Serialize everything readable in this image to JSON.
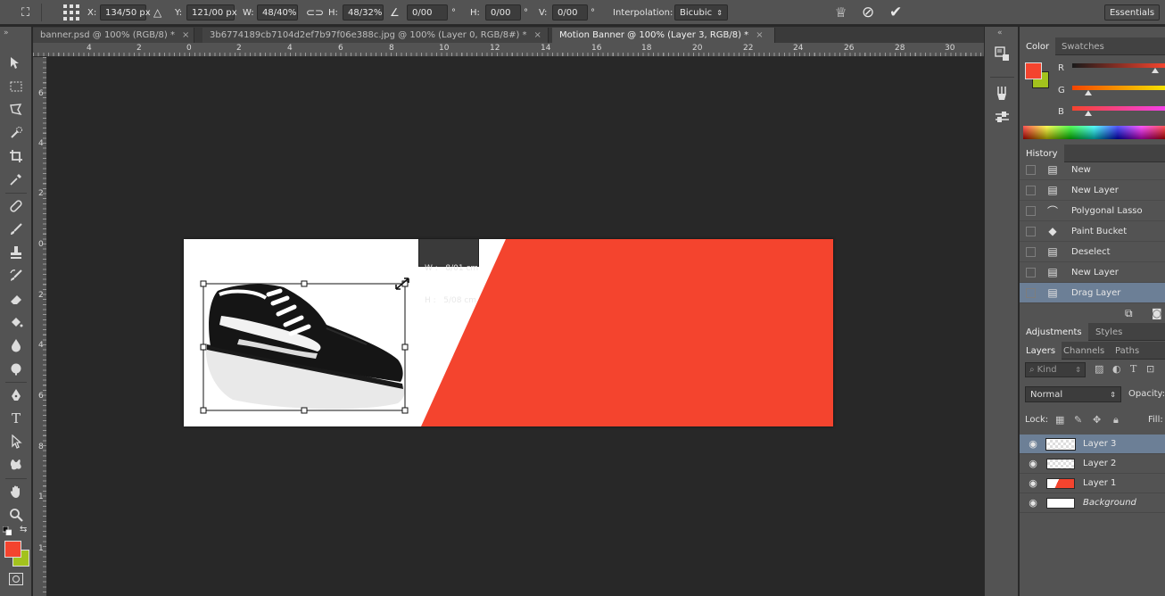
{
  "options": {
    "x_label": "X:",
    "x_value": "134/50 px",
    "delta_icon": "triangle-icon",
    "y_label": "Y:",
    "y_value": "121/00 px",
    "w_label": "W:",
    "w_value": "48/40%",
    "h_label": "H:",
    "h_value": "48/32%",
    "angle_value": "0/00",
    "degree_symbol": "°",
    "hskew_label": "H:",
    "hskew_value": "0/00",
    "vskew_label": "V:",
    "vskew_value": "0/00",
    "interp_label": "Interpolation:",
    "interp_value": "Bicubic",
    "workspace": "Essentials"
  },
  "tabs": [
    {
      "label": "banner.psd @ 100% (RGB/8) *",
      "close": "×"
    },
    {
      "label": "3b6774189cb7104d2ef7b97f06e388c.jpg @ 100% (Layer 0, RGB/8#) *",
      "close": "×"
    },
    {
      "label": "Motion Banner @ 100% (Layer 3, RGB/8) *",
      "close": "×"
    }
  ],
  "ruler_h": [
    "4",
    "2",
    "0",
    "2",
    "4",
    "6",
    "8",
    "10",
    "12",
    "14",
    "16",
    "18",
    "20",
    "22",
    "24",
    "26",
    "28",
    "30"
  ],
  "ruler_v": [
    "6",
    "4",
    "2",
    "0",
    "2",
    "4",
    "6",
    "8",
    "1",
    "1"
  ],
  "tooltip": {
    "w": "W :   8/01 cm",
    "h": "H :   5/08 cm"
  },
  "color_panel": {
    "tabs": [
      "Color",
      "Swatches"
    ],
    "r_label": "R",
    "g_label": "G",
    "b_label": "B",
    "fg_color": "#f4442e",
    "bg_color": "#a3c21d"
  },
  "history": {
    "tab": "History",
    "items": [
      "New",
      "New Layer",
      "Polygonal Lasso",
      "Paint Bucket",
      "Deselect",
      "New Layer",
      "Drag Layer"
    ]
  },
  "adjustments_tabs": [
    "Adjustments",
    "Styles"
  ],
  "layers_panel": {
    "tabs": [
      "Layers",
      "Channels",
      "Paths"
    ],
    "kind": "Kind",
    "blend": "Normal",
    "opacity_label": "Opacity:",
    "lock_label": "Lock:",
    "fill_label": "Fill:",
    "layers": [
      {
        "name": "Layer 3",
        "selected": true
      },
      {
        "name": "Layer 2",
        "selected": false
      },
      {
        "name": "Layer 1",
        "selected": false
      },
      {
        "name": "Background",
        "selected": false
      }
    ]
  },
  "colors": {
    "accent": "#f4442e",
    "selection": "#6c7f96"
  }
}
